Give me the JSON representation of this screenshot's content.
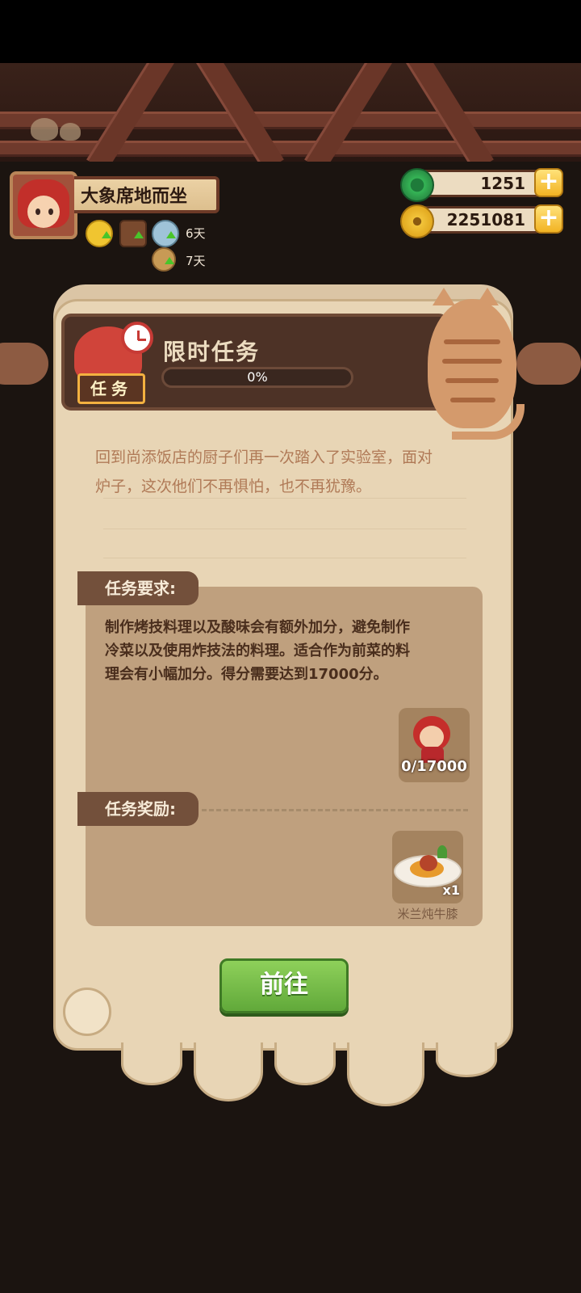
{
  "profile": {
    "name": "大象席地而坐",
    "buff_days_1": "6天",
    "buff_days_2": "7天"
  },
  "currency": {
    "jade": "1251",
    "coins": "2251081"
  },
  "task": {
    "title": "限时任务",
    "progress": "0%",
    "tag": "任务",
    "story_line1": "回到尚添饭店的厨子们再一次踏入了实验室，面对",
    "story_line2": "炉子，这次他们不再惧怕，也不再犹豫。",
    "requirements_label": "任务要求:",
    "requirements_line1": "制作烤技料理以及酸味会有额外加分，避免制作",
    "requirements_line2": "冷菜以及使用炸技法的料理。适合作为前菜的料",
    "requirements_line3": "理会有小幅加分。得分需要达到17000分。",
    "score_progress": "0/17000",
    "reward_label": "任务奖励:",
    "reward_qty": "x1",
    "reward_name": "米兰炖牛膝",
    "go_button": "前往"
  },
  "colors": {
    "accent_green": "#6fb845",
    "gold": "#f2b323",
    "panel": "#e8d5b5"
  },
  "icons": [
    "chef-avatar-icon",
    "coin-buff-icon",
    "stall-buff-icon",
    "pot-buff-icon",
    "tool-buff-icon",
    "jade-icon",
    "gold-coin-icon",
    "plus-icon",
    "clock-icon",
    "chef-icon",
    "dish-icon"
  ]
}
